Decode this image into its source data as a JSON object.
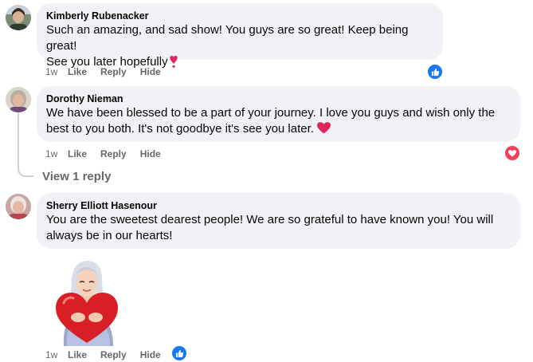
{
  "comments": [
    {
      "author": "Kimberly Rubenacker",
      "line1": "Such an amazing, and sad show! You guys are so great! Keep being great!",
      "line2": "See you later hopefully",
      "time": "1w",
      "like": "Like",
      "reply": "Reply",
      "hide": "Hide",
      "reaction": "like-icon"
    },
    {
      "author": "Dorothy Nieman",
      "line1": "We have been blessed to be a part of your journey. I love you guys and wish only the",
      "line2": "best to you both. It's not goodbye it's see you later.",
      "time": "1w",
      "like": "Like",
      "reply": "Reply",
      "hide": "Hide",
      "reaction": "love-icon",
      "view_replies": "View 1 reply"
    },
    {
      "author": "Sherry Elliott Hasenour",
      "line1": "You are the sweetest dearest people! We are so grateful to have known you! You will",
      "line2": "always be in our hearts!",
      "time": "1w",
      "like": "Like",
      "reply": "Reply",
      "hide": "Hide",
      "reaction": "like-icon",
      "sticker": "hugging-heart-sticker"
    }
  ],
  "colors": {
    "like_blue": "#1877f2",
    "love_red": "#f33e58",
    "bubble_bg": "#f0f2f5",
    "secondary_text": "#65676b"
  }
}
